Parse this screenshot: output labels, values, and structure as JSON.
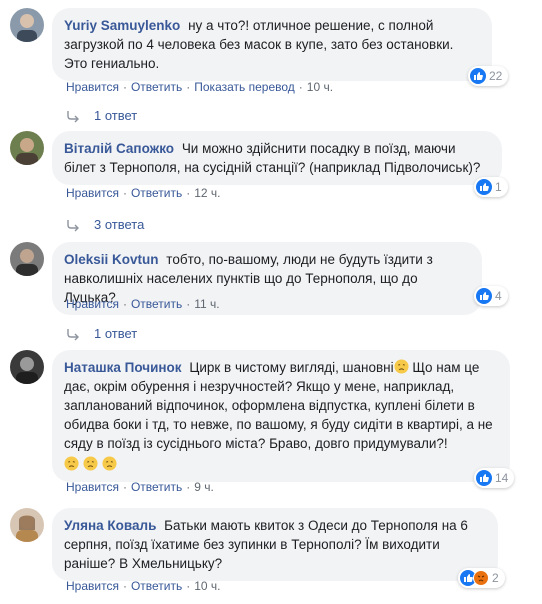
{
  "comments": [
    {
      "author": "Yuriy Samuylenko",
      "text": "ну а что?! отличное решение, с полной загрузкой по 4 человека без масок в купе, зато без остановки. Это гениально.",
      "actions": {
        "like": "Нравится",
        "reply": "Ответить",
        "translate": "Показать перевод",
        "time": "10 ч."
      },
      "reaction_count": "22",
      "replies_label": "1 ответ"
    },
    {
      "author": "Віталій Сапожко",
      "text": "Чи можно здійснити посадку в поїзд, маючи білет з Тернополя, на сусідній станції? (наприклад Підволочиськ)?",
      "actions": {
        "like": "Нравится",
        "reply": "Ответить",
        "time": "12 ч."
      },
      "reaction_count": "1",
      "replies_label": "3 ответа"
    },
    {
      "author": "Oleksii Kovtun",
      "text": "тобто, по-вашому, люди не будуть їздити з навколишніх населених пунктів що до Тернополя, що до Луцька?",
      "actions": {
        "like": "Нравится",
        "reply": "Ответить",
        "time": "11 ч."
      },
      "reaction_count": "4",
      "replies_label": "1 ответ"
    },
    {
      "author": "Наташка Починок",
      "text_line1": "Цирк в чистому вигляді, шановні",
      "text_line2": " Що нам це дає, окрім обурення і незручностей? Якщо у мене, наприклад, запланований відпочинок, оформлена відпустка, куплені білети в обидва боки і тд, то невже, по вашому, я буду сидіти в квартирі, а не сяду в поїзд із сусіднього міста? Браво, довго придумували?!",
      "actions": {
        "like": "Нравится",
        "reply": "Ответить",
        "time": "9 ч."
      },
      "reaction_count": "14"
    },
    {
      "author": "Уляна Коваль",
      "text": "Батьки мають квиток з Одеси до Тернополя на 6 серпня, поїзд їхатиме без зупинки в Тернополі? Їм виходити раніше? В Хмельницьку?",
      "actions": {
        "like": "Нравится",
        "reply": "Ответить",
        "time": "10 ч."
      },
      "reaction_count": "2"
    }
  ]
}
